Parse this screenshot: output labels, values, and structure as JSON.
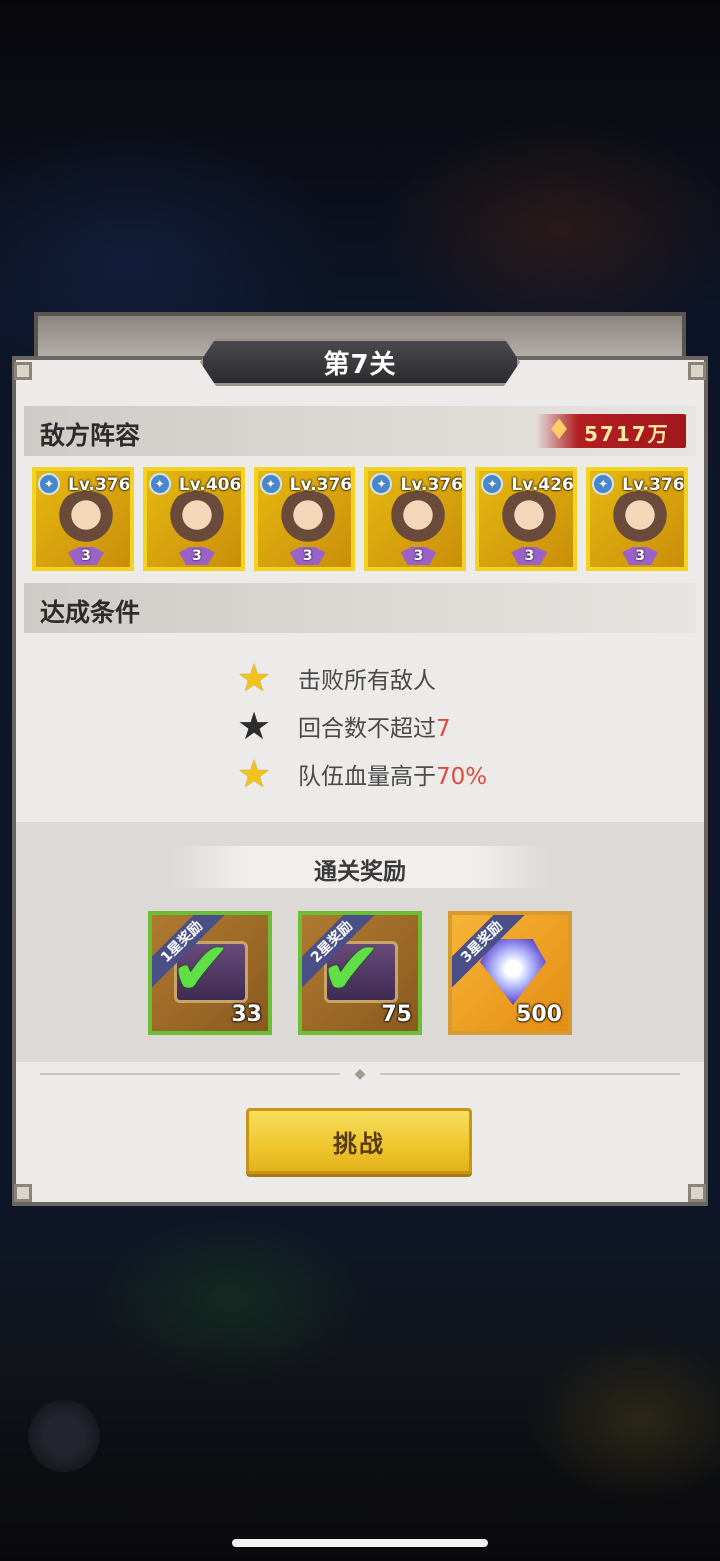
{
  "stage": {
    "title": "第7关"
  },
  "enemy": {
    "section_title": "敌方阵容",
    "power_value": "5717万",
    "heroes": [
      {
        "level": "Lv.376",
        "stars": "3"
      },
      {
        "level": "Lv.406",
        "stars": "3"
      },
      {
        "level": "Lv.376",
        "stars": "3"
      },
      {
        "level": "Lv.376",
        "stars": "3"
      },
      {
        "level": "Lv.426",
        "stars": "3"
      },
      {
        "level": "Lv.376",
        "stars": "3"
      }
    ]
  },
  "conditions": {
    "section_title": "达成条件",
    "items": [
      {
        "text": "击败所有敌人",
        "highlight": "",
        "achieved": true
      },
      {
        "text": "回合数不超过",
        "highlight": "7",
        "achieved": false
      },
      {
        "text": "队伍血量高于",
        "highlight": "70%",
        "achieved": true
      }
    ]
  },
  "rewards": {
    "title": "通关奖励",
    "items": [
      {
        "ribbon": "1星奖励",
        "count": "33",
        "claimed": true
      },
      {
        "ribbon": "2星奖励",
        "count": "75",
        "claimed": true
      },
      {
        "ribbon": "3星奖励",
        "count": "500",
        "claimed": false
      }
    ]
  },
  "actions": {
    "challenge_label": "挑战"
  },
  "colors": {
    "accent_gold": "#efc830",
    "highlight_red": "#e24b3b",
    "check_green": "#5fe046"
  }
}
